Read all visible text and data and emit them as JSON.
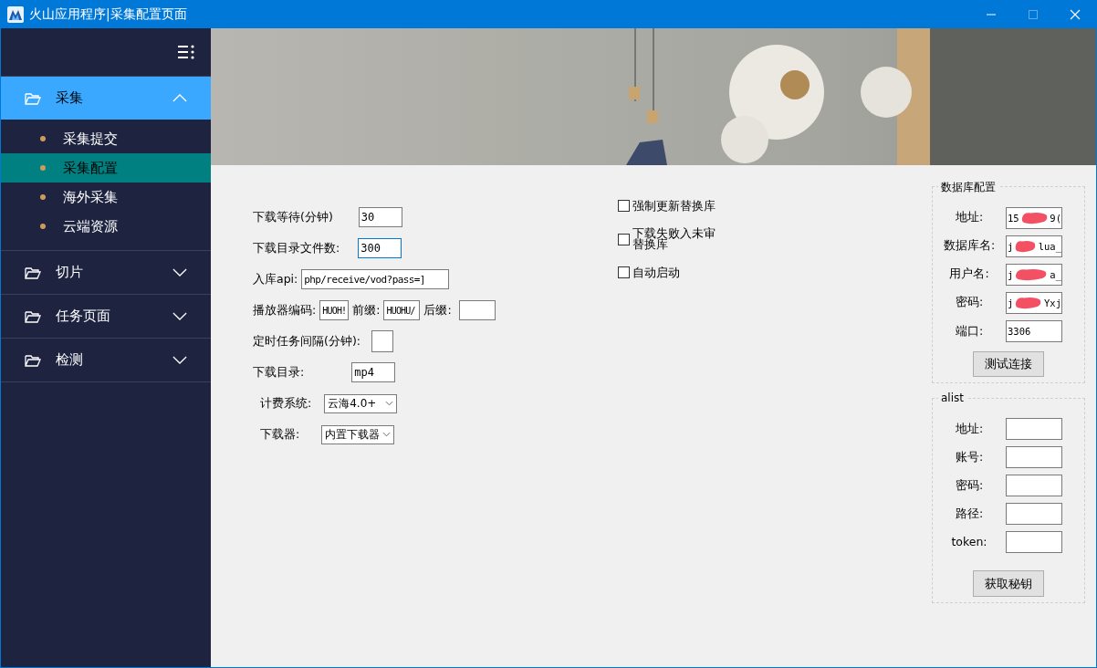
{
  "window": {
    "title": "火山应用程序|采集配置页面"
  },
  "sidebar": {
    "groups": [
      {
        "label": "采集",
        "expanded": true,
        "selected": true,
        "children": [
          {
            "label": "采集提交",
            "selected": false
          },
          {
            "label": "采集配置",
            "selected": true
          },
          {
            "label": "海外采集",
            "selected": false
          },
          {
            "label": "云端资源",
            "selected": false
          }
        ]
      },
      {
        "label": "切片",
        "expanded": false,
        "selected": false
      },
      {
        "label": "任务页面",
        "expanded": false,
        "selected": false
      },
      {
        "label": "检测",
        "expanded": false,
        "selected": false
      }
    ]
  },
  "form": {
    "rows": [
      {
        "fields": [
          {
            "kind": "input",
            "label": "下载等待(分钟)",
            "value": "30",
            "focused": false
          }
        ]
      },
      {
        "fields": [
          {
            "kind": "input",
            "label": "下载目录文件数:",
            "value": "300",
            "focused": true
          }
        ]
      },
      {
        "fields": [
          {
            "kind": "input",
            "label": "入库api:",
            "value": "php/receive/vod?pass=]",
            "focused": false
          }
        ]
      },
      {
        "fields": [
          {
            "kind": "input",
            "label": "播放器编码:",
            "value": "HUOH!",
            "focused": false
          },
          {
            "kind": "input",
            "label": "前缀:",
            "value": "HUOHU/",
            "focused": false
          },
          {
            "kind": "input",
            "label": "后缀:",
            "focused": false
          }
        ]
      },
      {
        "fields": [
          {
            "kind": "input",
            "label": "定时任务间隔(分钟):",
            "focused": false
          }
        ]
      },
      {
        "fields": [
          {
            "kind": "input",
            "label": "下载目录:",
            "value": "mp4",
            "focused": false
          }
        ]
      },
      {
        "fields": [
          {
            "kind": "select",
            "label": "计费系统:",
            "value": "云海4.0+"
          }
        ]
      },
      {
        "fields": [
          {
            "kind": "select",
            "label": "下载器:",
            "value": "内置下载器"
          }
        ]
      }
    ]
  },
  "options": [
    {
      "label": "强制更新替换库",
      "checked": false
    },
    {
      "label": "下载失败入未审替换库",
      "checked": false
    },
    {
      "label": "自动启动",
      "checked": false
    }
  ],
  "database": {
    "title": "数据库配置",
    "fields": [
      {
        "label": "地址:",
        "value_start": "15",
        "value_end": "9(",
        "redacted": true
      },
      {
        "label": "数据库名:",
        "value_start": "j",
        "value_end": "lua_",
        "redacted": true
      },
      {
        "label": "用户名:",
        "value_start": "j",
        "value_end": "a_",
        "redacted": true
      },
      {
        "label": "密码:",
        "value_start": "j",
        "value_end": "Yxj",
        "redacted": true
      },
      {
        "label": "端口:",
        "value_start": "3306"
      }
    ],
    "button": "测试连接"
  },
  "alist": {
    "title": "alist",
    "fields": [
      {
        "label": "地址:"
      },
      {
        "label": "账号:"
      },
      {
        "label": "密码:"
      },
      {
        "label": "路径:"
      },
      {
        "label": "token:"
      }
    ],
    "button": "获取秘钥"
  }
}
